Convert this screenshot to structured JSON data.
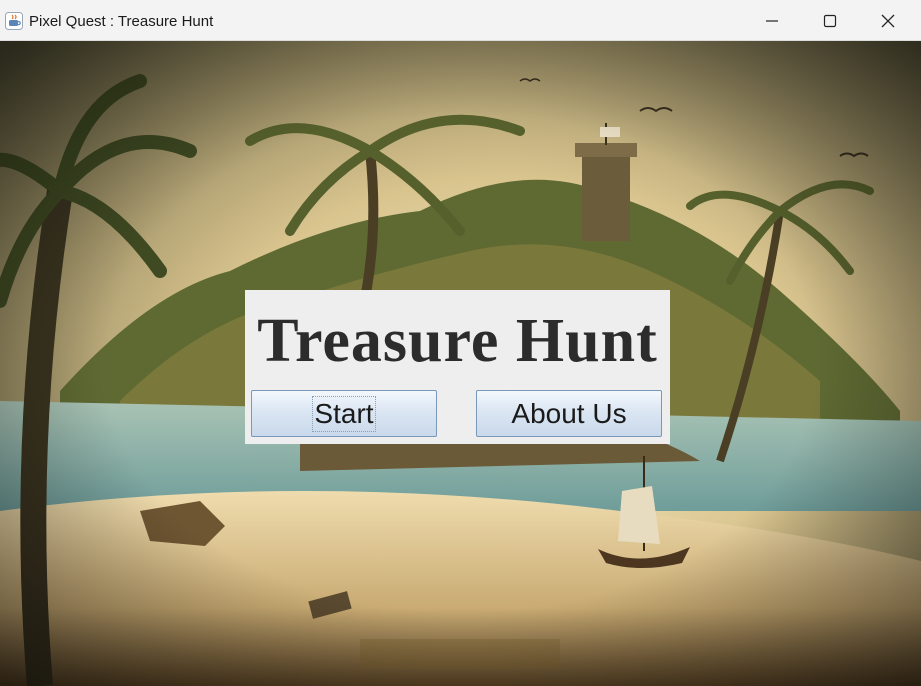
{
  "window": {
    "title": "Pixel Quest : Treasure Hunt"
  },
  "menu": {
    "title": "Treasure Hunt",
    "start_label": "Start",
    "about_label": "About Us"
  },
  "colors": {
    "panel": "#eeeeee",
    "button_border": "#7a98ba",
    "title_text": "#2c2c2c"
  },
  "icons": [
    "java-app-icon",
    "minimize-icon",
    "maximize-icon",
    "close-icon"
  ]
}
